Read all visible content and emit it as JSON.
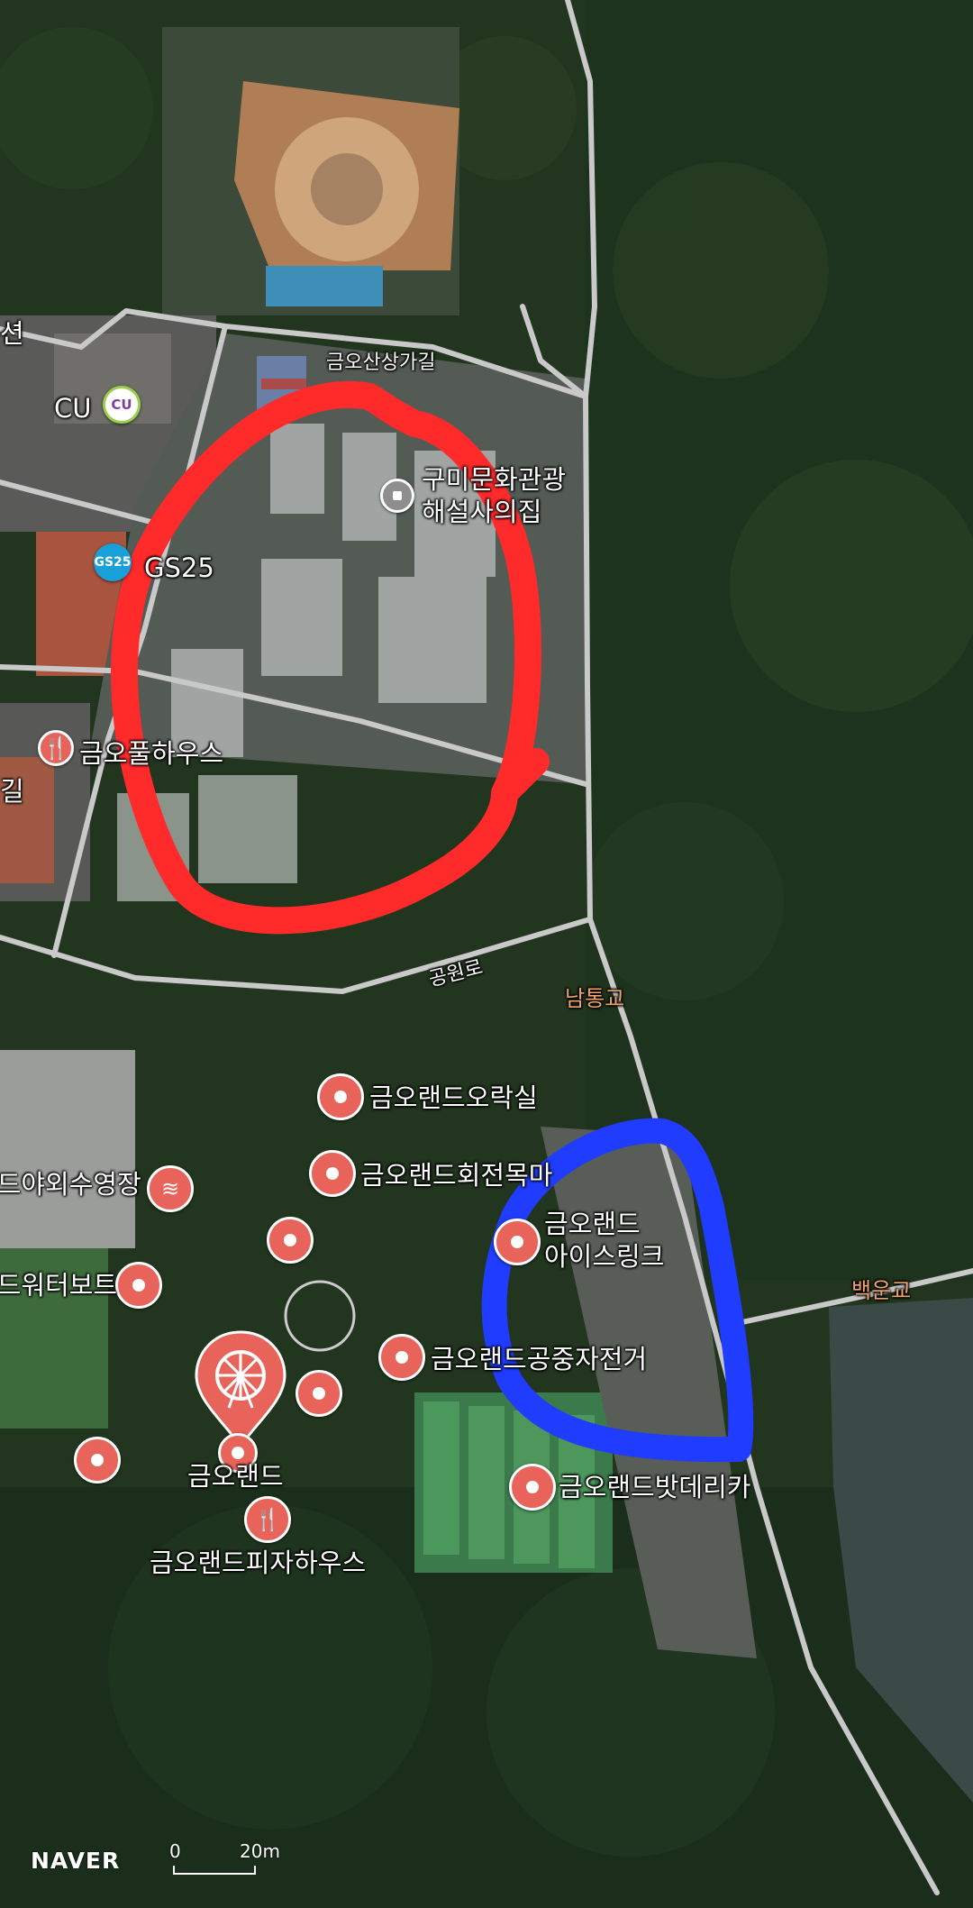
{
  "map": {
    "attribution": "NAVER",
    "scale": {
      "start": "0",
      "end": "20m"
    }
  },
  "roads": {
    "geumosan": "금오산상가길",
    "gongwon": "공원로",
    "partial_left_1": "션",
    "partial_left_2": "길"
  },
  "bridges": {
    "namtong": "남통교",
    "baegun": "백운교"
  },
  "stores": {
    "cu": "CU",
    "cu_icon": "CU",
    "gs_icon": "GS25",
    "gs25": "GS25"
  },
  "pois": {
    "gumi_culture": "구미문화관광\n해설사의집",
    "pool_house": "금오풀하우스",
    "arcade": "금오랜드오락실",
    "carousel": "금오랜드회전목마",
    "outdoor_pool": "랜드야외수영장",
    "water_boat": "랜드워터보트",
    "ice_rink": "금오랜드\n아이스링크",
    "sky_bike": "금오랜드공중자전거",
    "geumoland": "금오랜드",
    "pizza_house": "금오랜드피자하우스",
    "bat_car": "금오랜드밧데리카"
  },
  "annotations": {
    "red_circle_color": "#ff2a2a",
    "blue_circle_color": "#1f3cff"
  },
  "colors": {
    "pin": "#e8635a",
    "road": "#c9c9c9",
    "bridge_label": "#f0a36a"
  }
}
